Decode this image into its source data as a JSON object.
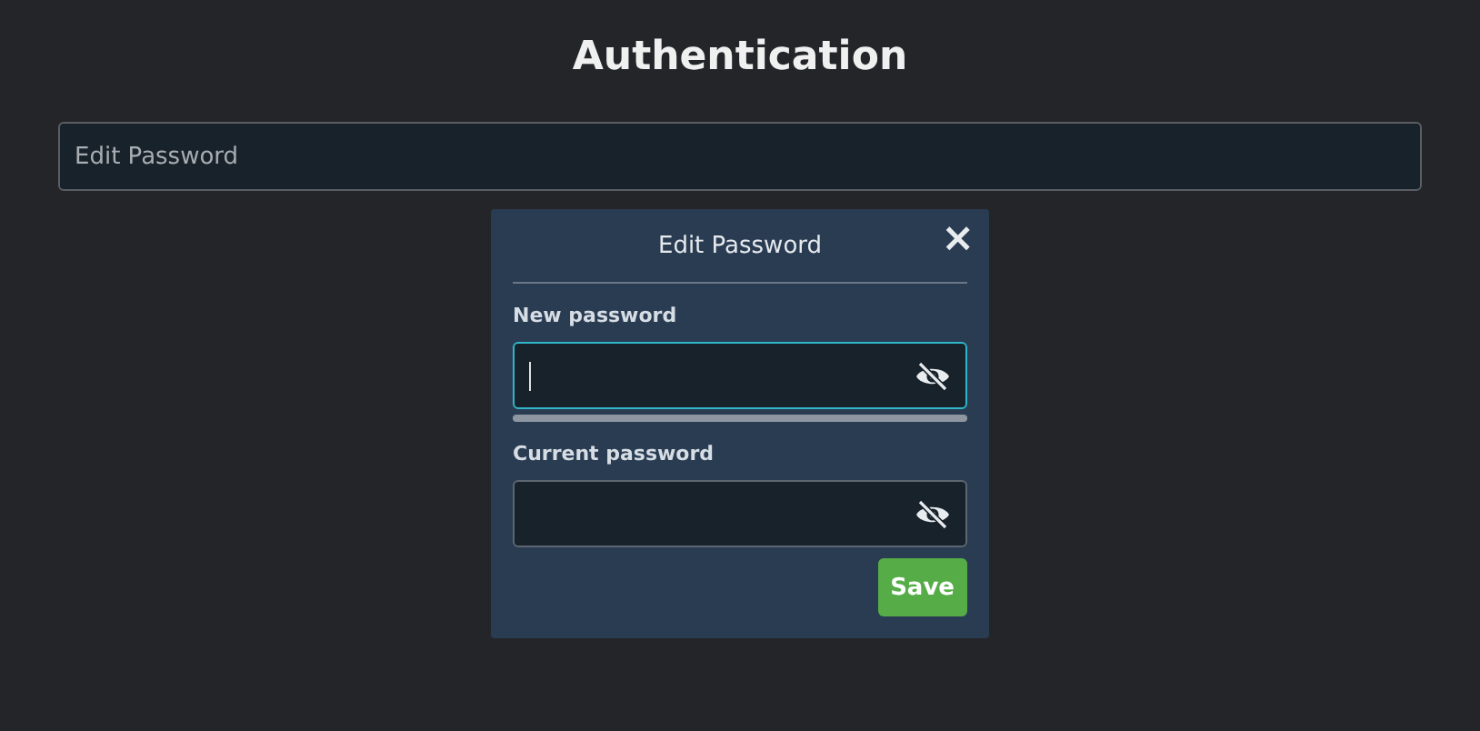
{
  "page": {
    "title": "Authentication"
  },
  "edit_button": {
    "label": "Edit Password"
  },
  "dialog": {
    "title": "Edit Password",
    "close": "×",
    "fields": [
      {
        "label": "New password",
        "focused": true,
        "strength": {
          "level": 0
        }
      },
      {
        "label": "Current password",
        "focused": false
      }
    ],
    "save": "Save"
  }
}
